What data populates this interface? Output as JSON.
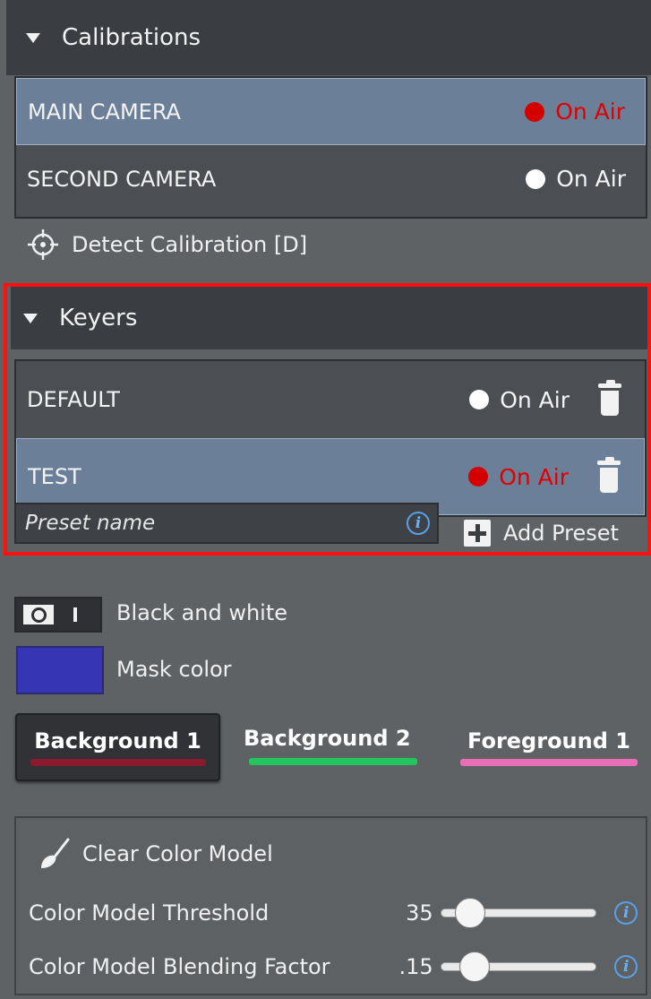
{
  "calibrations": {
    "title": "Calibrations",
    "items": [
      {
        "name": "MAIN CAMERA",
        "status": "On Air",
        "live": true
      },
      {
        "name": "SECOND CAMERA",
        "status": "On Air",
        "live": false
      }
    ],
    "detect_label": "Detect Calibration [D]"
  },
  "keyers": {
    "title": "Keyers",
    "items": [
      {
        "name": "DEFAULT",
        "status": "On Air",
        "live": false
      },
      {
        "name": "TEST",
        "status": "On Air",
        "live": true
      }
    ],
    "preset_placeholder": "Preset name",
    "add_preset_label": "Add Preset"
  },
  "options": {
    "black_white_label": "Black and white",
    "mask_color_label": "Mask color",
    "mask_color": "#3636b4"
  },
  "layers": [
    {
      "label": "Background 1",
      "color": "#8a1a2e",
      "active": true
    },
    {
      "label": "Background 2",
      "color": "#22c55e",
      "active": false
    },
    {
      "label": "Foreground 1",
      "color": "#e86fb6",
      "active": false
    }
  ],
  "color_model": {
    "clear_label": "Clear Color Model",
    "threshold_label": "Color Model Threshold",
    "threshold_value": "35",
    "threshold_fraction": 0.11,
    "blending_label": "Color Model Blending Factor",
    "blending_value": ".15",
    "blending_fraction": 0.15
  },
  "colors": {
    "live_red": "#e00000",
    "selected_row": "#6b7f98",
    "highlight_frame": "#ff1010",
    "info_blue": "#5aa0e6"
  }
}
